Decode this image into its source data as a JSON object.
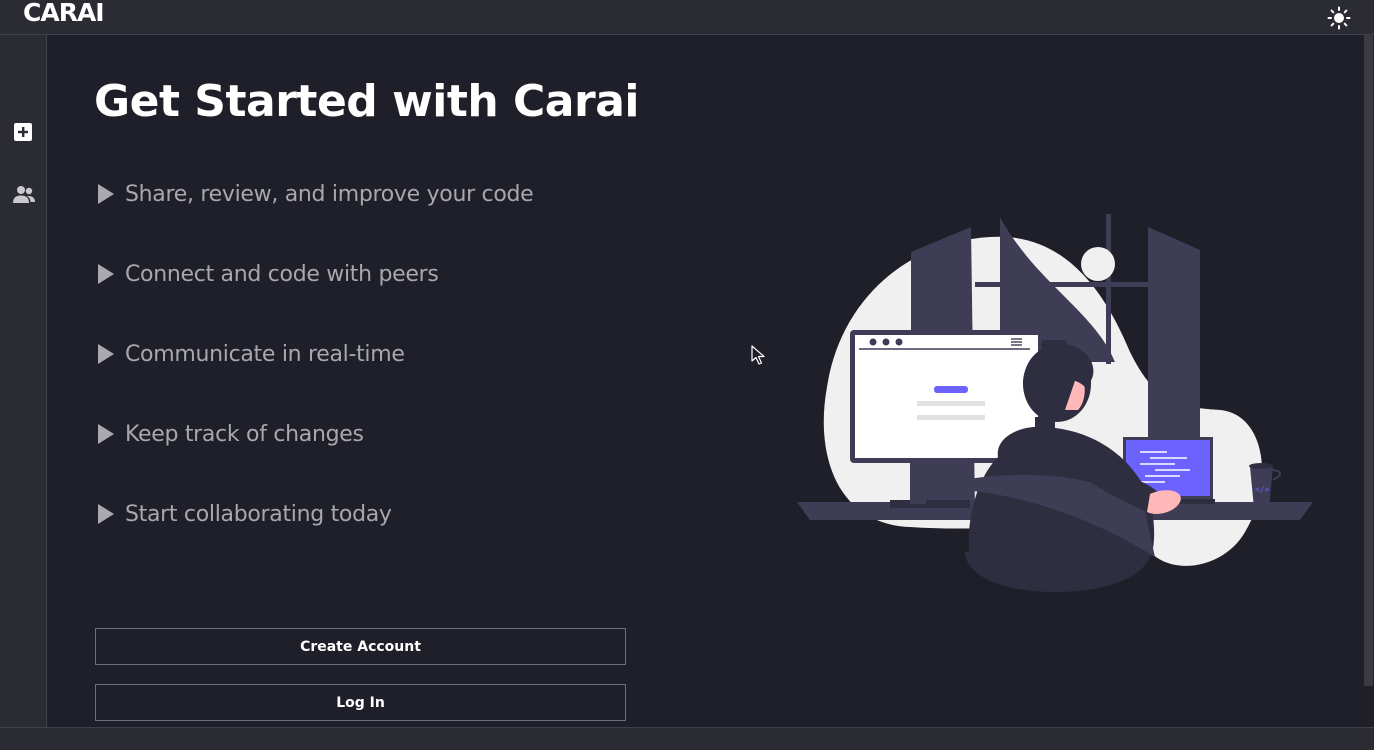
{
  "app": {
    "logo": "CARAI"
  },
  "topbar": {
    "theme_toggle_icon": "sun-icon"
  },
  "sidebar": {
    "items": [
      {
        "icon": "plus-square-icon"
      },
      {
        "icon": "users-icon"
      }
    ]
  },
  "main": {
    "title": "Get Started with Carai",
    "features": [
      "Share, review, and improve your code",
      "Connect and code with peers",
      "Communicate in real-time",
      "Keep track of changes",
      "Start collaborating today"
    ],
    "create_account_label": "Create Account",
    "login_label": "Log In"
  },
  "colors": {
    "background": "#1f1f29",
    "panel": "#2b2b33",
    "accent": "#6c63ff",
    "feature_text": "#a7a7ad"
  }
}
